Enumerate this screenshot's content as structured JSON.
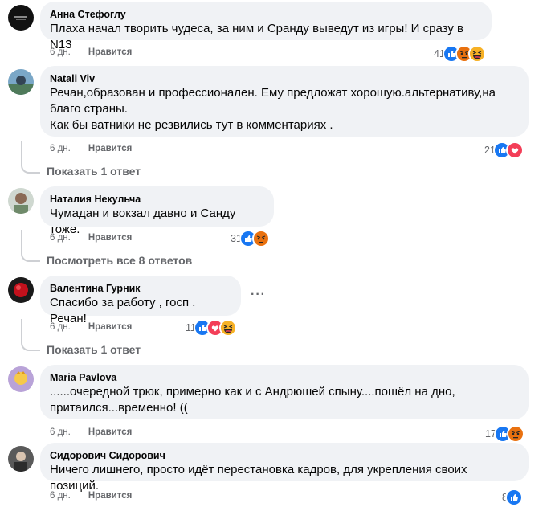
{
  "comments": [
    {
      "author": "Анна Стефоглу",
      "lines": [
        "Плаха начал творить чудеса, за ним и Сранду выведут из игры! И сразу в N13"
      ],
      "time": "6 дн.",
      "like_label": "Нравится",
      "reaction_count": "41",
      "reaction_icons": [
        "like-reaction-icon",
        "angry-reaction-icon",
        "haha-reaction-icon"
      ]
    },
    {
      "author": "Natali Viv",
      "lines": [
        "Речан,образован и профессионален. Ему предложат хорошую.альтернативу,на",
        "благо страны.",
        "Как бы ватники не резвились тут в комментариях ."
      ],
      "time": "6 дн.",
      "like_label": "Нравится",
      "reaction_count": "21",
      "reaction_icons": [
        "like-reaction-icon",
        "love-reaction-icon"
      ],
      "replies_label": "Показать 1 ответ"
    },
    {
      "author": "Наталия Некульча",
      "lines": [
        "Чумадан и вокзал давно и Санду тоже."
      ],
      "time": "6 дн.",
      "like_label": "Нравится",
      "reaction_count": "31",
      "reaction_icons": [
        "like-reaction-icon",
        "angry-reaction-icon"
      ],
      "replies_label": "Посмотреть все 8 ответов"
    },
    {
      "author": "Валентина Гурник",
      "lines": [
        "Спасибо за работу , госп . Речан!"
      ],
      "time": "6 дн.",
      "like_label": "Нравится",
      "reaction_count": "11",
      "reaction_icons": [
        "like-reaction-icon",
        "love-reaction-icon",
        "haha-reaction-icon"
      ],
      "replies_label": "Показать 1 ответ",
      "more_label": "···"
    },
    {
      "author": "Maria Pavlova",
      "lines": [
        "......очередной трюк, примерно как и с Андрюшей спыну....пошёл на дно,",
        "притаился...временно! (("
      ],
      "time": "6 дн.",
      "like_label": "Нравится",
      "reaction_count": "17",
      "reaction_icons": [
        "like-reaction-icon",
        "angry-reaction-icon"
      ]
    },
    {
      "author": "Сидорович Сидорович",
      "lines": [
        "Ничего лишнего, просто идёт перестановка кадров, для укрепления своих позиций."
      ],
      "time": "6 дн.",
      "like_label": "Нравится",
      "reaction_count": "8",
      "reaction_icons": [
        "like-reaction-icon"
      ]
    }
  ],
  "colors": {
    "bubble": "#f0f2f5",
    "meta": "#65676b",
    "like": "#1877f2",
    "love": "#f33e58",
    "angry": "#e9710f",
    "haha": "#f7b125"
  }
}
